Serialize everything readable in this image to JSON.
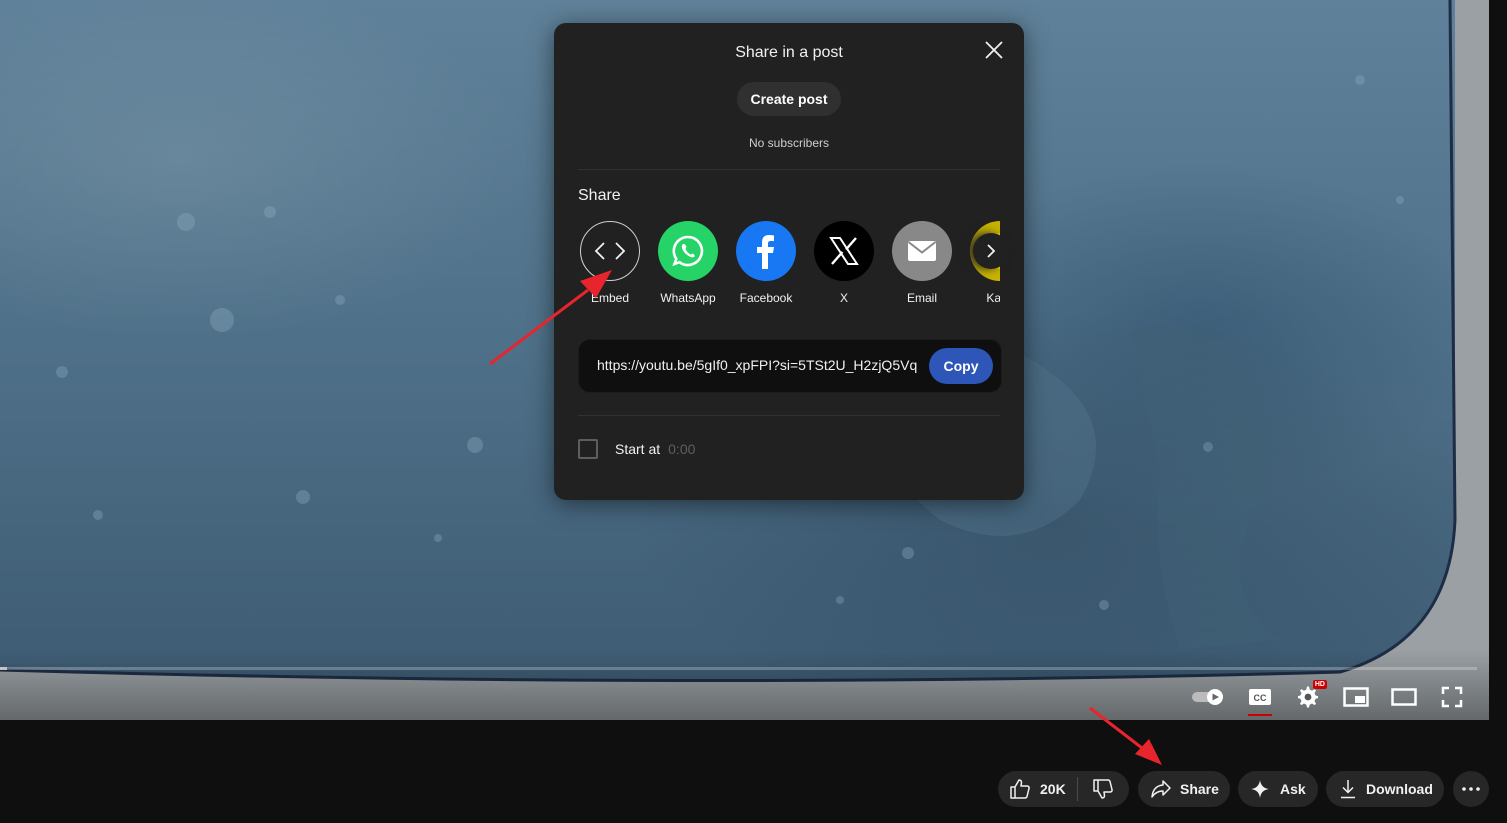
{
  "modal": {
    "title": "Share in a post",
    "create_post_label": "Create post",
    "subscribers_text": "No subscribers",
    "share_heading": "Share",
    "share_targets": [
      {
        "label": "Embed",
        "icon": "embed-icon",
        "color": "#212121"
      },
      {
        "label": "WhatsApp",
        "icon": "whatsapp-icon",
        "color": "#25d366"
      },
      {
        "label": "Facebook",
        "icon": "facebook-icon",
        "color": "#1877f2"
      },
      {
        "label": "X",
        "icon": "x-icon",
        "color": "#000000"
      },
      {
        "label": "Email",
        "icon": "email-icon",
        "color": "#888888"
      },
      {
        "label": "Kaka",
        "icon": "kakaotalk-icon",
        "color": "#ffe812"
      }
    ],
    "link": "https://youtu.be/5gIf0_xpFPI?si=5TSt2U_H2zjQ5Vq",
    "copy_label": "Copy",
    "start_at_label": "Start at",
    "start_at_time": "0:00"
  },
  "player": {
    "progress": 0.005,
    "controls": [
      "autoplay-toggle-icon",
      "captions-icon",
      "settings-icon",
      "miniplayer-icon",
      "theater-mode-icon",
      "fullscreen-icon"
    ],
    "hd_badge": "HD"
  },
  "actions": {
    "like_count": "20K",
    "share_label": "Share",
    "ask_label": "Ask",
    "download_label": "Download"
  },
  "colors": {
    "modal_bg": "#212121",
    "copy_button": "#2e55b8",
    "annotation_arrow": "#e8242d"
  }
}
